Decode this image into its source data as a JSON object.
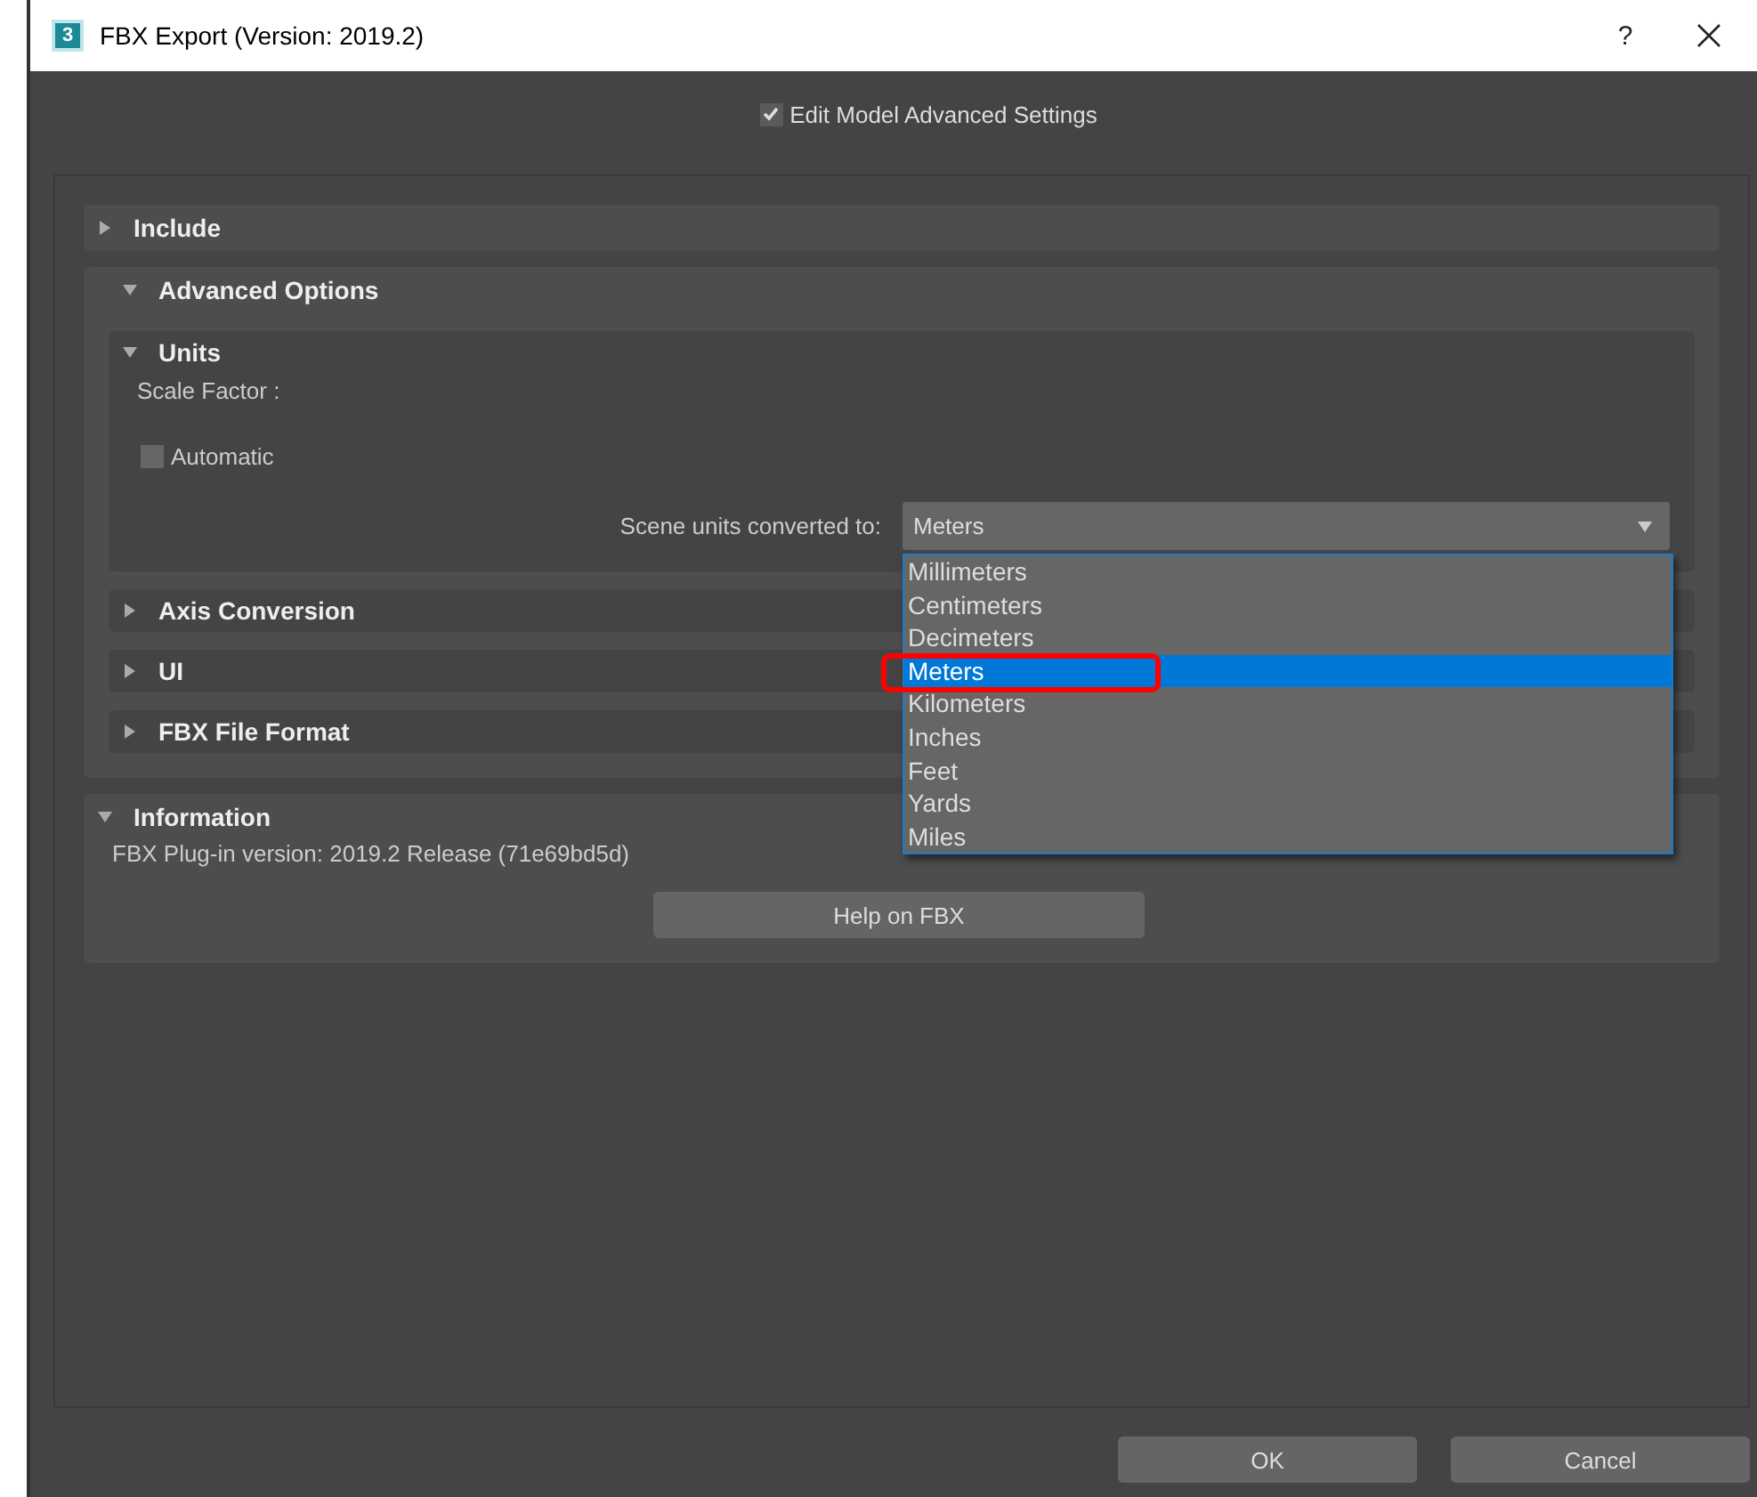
{
  "window": {
    "icon_text": "3",
    "title": "FBX Export (Version: 2019.2)",
    "help": "?"
  },
  "edit_model": {
    "label": "Edit Model Advanced Settings",
    "checked": true
  },
  "include": {
    "title": "Include",
    "expanded": false
  },
  "advanced_options": {
    "title": "Advanced Options",
    "expanded": true,
    "units": {
      "title": "Units",
      "expanded": true,
      "scale_factor_label": "Scale Factor :",
      "automatic": {
        "label": "Automatic",
        "checked": false
      },
      "scene_units": {
        "label": "Scene units converted to:",
        "value": "Meters",
        "open": true,
        "options": [
          {
            "label": "Millimeters",
            "selected": false
          },
          {
            "label": "Centimeters",
            "selected": false
          },
          {
            "label": "Decimeters",
            "selected": false
          },
          {
            "label": "Meters",
            "selected": true
          },
          {
            "label": "Kilometers",
            "selected": false
          },
          {
            "label": "Inches",
            "selected": false
          },
          {
            "label": "Feet",
            "selected": false
          },
          {
            "label": "Yards",
            "selected": false
          },
          {
            "label": "Miles",
            "selected": false
          }
        ]
      }
    },
    "subsections": [
      {
        "title": "Axis Conversion",
        "expanded": false
      },
      {
        "title": "UI",
        "expanded": false
      },
      {
        "title": "FBX File Format",
        "expanded": false
      }
    ]
  },
  "information": {
    "title": "Information",
    "expanded": true,
    "version_text": "FBX Plug-in version: 2019.2 Release (71e69bd5d)",
    "help_button": "Help on FBX"
  },
  "buttons": [
    "OK",
    "Cancel"
  ]
}
